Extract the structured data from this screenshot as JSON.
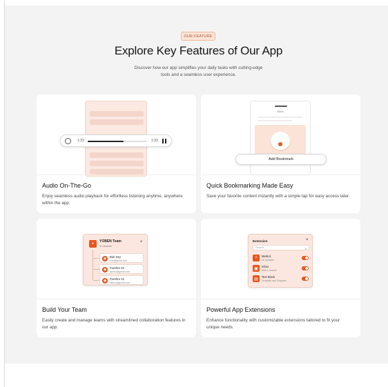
{
  "section": {
    "badge": "OUR FEATURE",
    "title": "Explore Key Features of Our App",
    "subtitle": "Discover how our app simplifies your daily tasks with cutting-edge tools and a seamless user experience."
  },
  "cards": [
    {
      "title": "Audio On-The-Go",
      "description": "Enjoy seamless audio playback for effortless listening anytime, anywhere within the app.",
      "player": {
        "current_time": "1:33",
        "total_time": "1:33",
        "progress": 0.6
      }
    },
    {
      "title": "Quick Bookmarking Made Easy",
      "description": "Save your favorite content instantly with a simple tap for easy access later.",
      "mock_header": "Save",
      "button_label": "Add Bookmark"
    },
    {
      "title": "Build Your Team",
      "description": "Easily create and manage teams with streamlined collaboration features in our app.",
      "team": {
        "name": "YOBEN Team",
        "count": "3 member",
        "members": [
          {
            "name": "Bob Dey",
            "email": "bob@gmail.com"
          },
          {
            "name": "Fazzbro 32",
            "email": "fazbro@gmail.com"
          },
          {
            "name": "Fazzbro 32",
            "email": "fazbro@gmail.com"
          }
        ]
      }
    },
    {
      "title": "Powerful App Extensions",
      "description": "Enhance functionality with customizable extensions tailored to fit your unique needs.",
      "extensions": {
        "header": "Extension",
        "search_placeholder": "Search",
        "items": [
          {
            "name": "Metrics",
            "sub": "All Updates"
          },
          {
            "name": "Inbox",
            "sub": "Add to search"
          },
          {
            "name": "Text Block",
            "sub": "Template and Snippets"
          }
        ]
      }
    }
  ],
  "colors": {
    "accent": "#e8551c",
    "section_bg": "#f3f3f3",
    "badge_bg": "#fbe3d7"
  }
}
